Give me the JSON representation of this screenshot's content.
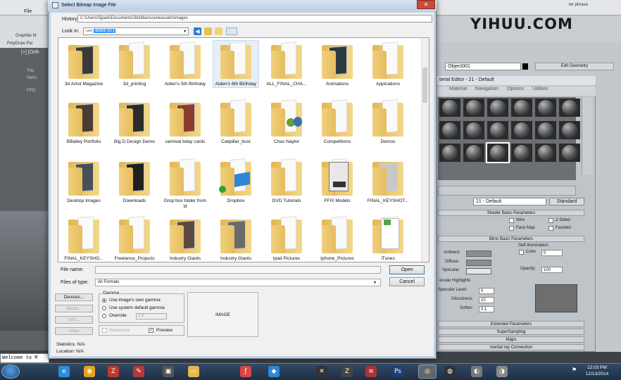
{
  "max": {
    "file_menu": "File",
    "ribbon_label_1": "Graphite M",
    "ribbon_label_2": "PolyDraw  Pai",
    "viewport_label": "[+] [Orth",
    "vp_stats": [
      "Tris:",
      "Verts:",
      "FPS:"
    ],
    "maxscript": "Welcome to M",
    "watermark": "YIHUU.COM",
    "watermark_url": "ter phrase",
    "object_name": "Object001",
    "modifier_button": "Edit Geometry"
  },
  "material_editor": {
    "title": "terial Editor - 21 - Default",
    "menu": [
      "Material",
      "Navigation",
      "Options",
      "Utilities"
    ],
    "material_name": "21 - Default",
    "material_type": "Standard",
    "rollout_shader": "Shader Basic Parameters",
    "opt_wire": "Wire",
    "opt_2sided": "2-Sided",
    "opt_facemap": "Face Map",
    "opt_faceted": "Faceted",
    "rollout_blinn": "Blinn Basic Parameters",
    "self_illum": "Self-Illumination",
    "color_label": "Color",
    "color_val": "0",
    "ambient": "Ambient:",
    "diffuse": "Diffuse:",
    "specular": "Specular:",
    "opacity": "Opacity:",
    "opacity_val": "100",
    "spec_highlights": "ecular Highlights",
    "spec_level": "Specular Level:",
    "spec_level_val": "0",
    "glossiness": "Glossiness:",
    "glossiness_val": "10",
    "soften": "Soften:",
    "soften_val": "0.1",
    "rollouts": [
      "Extended Parameters",
      "SuperSampling",
      "Maps",
      "mental ray Connection"
    ]
  },
  "dialog": {
    "title": "Select Bitmap Image File",
    "close": "✕",
    "history_label": "History:",
    "history_path": "C:\\Users\\Sjpark\\Documents\\3dsMax\\sceneassets\\images",
    "lookin_label": "Look in:",
    "lookin_prefix": "user",
    "lookin_value": "Blank (D:)",
    "folders": [
      {
        "name": "3d Artist Magazine",
        "kind": "image",
        "img": "#3a3a3a"
      },
      {
        "name": "3d_printing",
        "kind": "paper"
      },
      {
        "name": "Aiden's 5th Birthday",
        "kind": "paper"
      },
      {
        "name": "Aiden's 6th Birthday",
        "kind": "paper",
        "sel": true
      },
      {
        "name": "ALL_FINAL_CHA...",
        "kind": "paper"
      },
      {
        "name": "Animations",
        "kind": "image",
        "img": "#2d3a40"
      },
      {
        "name": "Appications",
        "kind": "paper"
      },
      {
        "name": "BBailey Portfolio",
        "kind": "image",
        "img": "#4a3c34"
      },
      {
        "name": "Big D Design Demo",
        "kind": "image",
        "img": "#2b2b2b"
      },
      {
        "name": "carnival bday cards",
        "kind": "image",
        "img": "#8a3b2e"
      },
      {
        "name": "Catipillar_bust",
        "kind": "paper"
      },
      {
        "name": "Chas Naylor",
        "kind": "people"
      },
      {
        "name": "Competitions",
        "kind": "paper"
      },
      {
        "name": "Demos",
        "kind": "paper"
      },
      {
        "name": "Desktop Images",
        "kind": "image",
        "img": "#45505a"
      },
      {
        "name": "Downloads",
        "kind": "image",
        "img": "#1f1f1f"
      },
      {
        "name": "Drop box folder from id",
        "kind": "paper"
      },
      {
        "name": "Dropbox",
        "kind": "dropbox"
      },
      {
        "name": "DVD Tutorials",
        "kind": "paper"
      },
      {
        "name": "FFIX Models",
        "kind": "max"
      },
      {
        "name": "FINAL_KEYSHOT...",
        "kind": "image",
        "img": "#c8c8c8"
      },
      {
        "name": "FINAL_KEYSHO...",
        "kind": "paper"
      },
      {
        "name": "Freelance_Projects",
        "kind": "paper"
      },
      {
        "name": "Industry Giants",
        "kind": "image",
        "img": "#5a4a40"
      },
      {
        "name": "Industry Giants",
        "kind": "image",
        "img": "#6a6a6a"
      },
      {
        "name": "Ipad Pictures",
        "kind": "paper"
      },
      {
        "name": "Iphone_Pictures",
        "kind": "paper"
      },
      {
        "name": "iTunes",
        "kind": "itunes"
      }
    ],
    "filename_label": "File name:",
    "filename_value": "",
    "filetype_label": "Files of type:",
    "filetype_value": "All Formats",
    "open": "Open",
    "cancel": "Cancel",
    "side_buttons": [
      "Devices...",
      "Setup...",
      "Info...",
      "View"
    ],
    "gamma_title": "Gamma",
    "gamma_opt1": "Use image's own gamma",
    "gamma_opt2": "Use system default gamma",
    "gamma_opt3": "Override",
    "override_value": "1.0",
    "sequence": "Sequence",
    "preview": "Preview",
    "image_label": "IMAGE",
    "statistics": "Statistics: N/A",
    "location": "Location: N/A"
  },
  "taskbar": {
    "apps": [
      "ie-icon",
      "chrome-icon",
      "filezilla-icon",
      "pen-icon",
      "monitor-icon",
      "folder-icon",
      "flash-icon",
      "dropbox-icon",
      "x-icon",
      "zbrush-icon",
      "sculpt-icon",
      "photoshop-icon",
      "game-icon",
      "steam-icon",
      "disc-icon",
      "disc2-icon"
    ],
    "time": "12:03 PM",
    "date": "12/13/2014"
  },
  "colors": {
    "folder": "#f0cf7d",
    "selection": "#3399ff",
    "close": "#c74a3b"
  }
}
